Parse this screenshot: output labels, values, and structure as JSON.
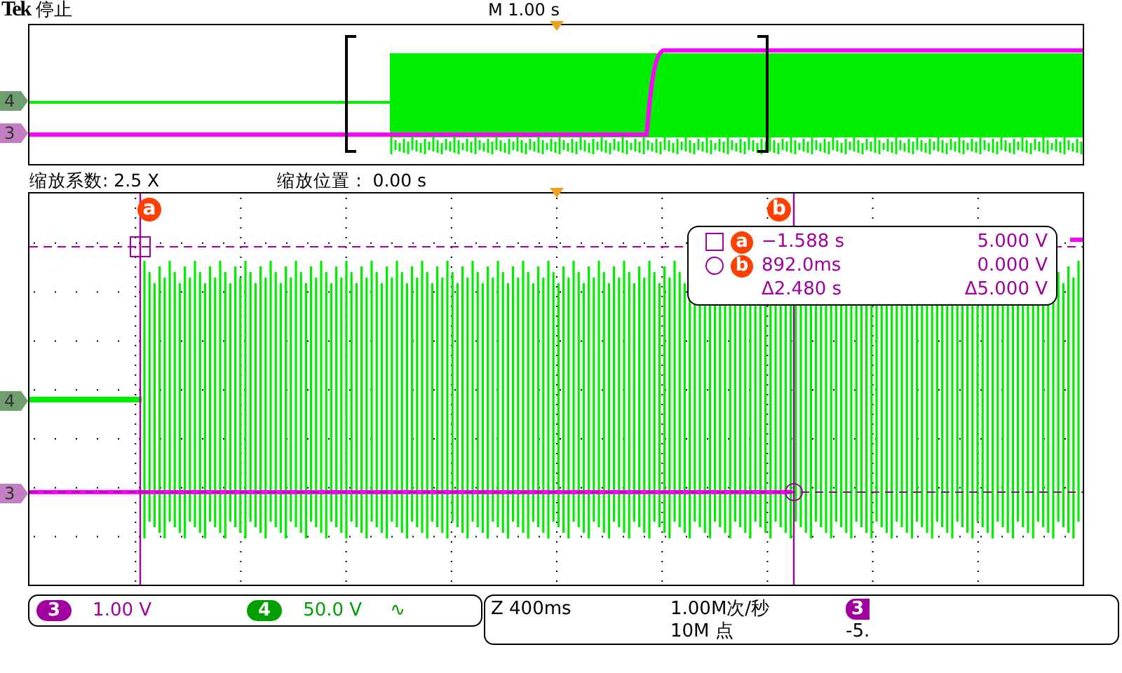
{
  "header": {
    "brand": "Tek",
    "status": "停止",
    "timebase": "M 1.00 s"
  },
  "overview": {
    "channel_markers": [
      {
        "label": "4",
        "color": "#6f9f6f"
      },
      {
        "label": "3",
        "color": "#c47fc4"
      }
    ]
  },
  "zoom_info": {
    "factor": "缩放系数: 2.5 X",
    "position": "缩放位置 :  0.00 s"
  },
  "main": {
    "channel_markers": [
      {
        "label": "4",
        "color": "#6f9f6f"
      },
      {
        "label": "3",
        "color": "#c47fc4"
      }
    ],
    "cursor_labels": [
      "a",
      "b"
    ],
    "readout": [
      {
        "kind": "square",
        "cursor": "a",
        "time": "−1.588 s",
        "value": "5.000 V"
      },
      {
        "kind": "circle",
        "cursor": "b",
        "time": "892.0ms",
        "value": "0.000 V"
      },
      {
        "kind": "delta",
        "time": "Δ2.480 s",
        "value": "Δ5.000 V"
      }
    ]
  },
  "status_bar": {
    "channels": [
      {
        "number": "3",
        "scale": "1.00 V",
        "color": "#a000a0"
      },
      {
        "number": "4",
        "scale": "50.0 V",
        "color": "#00a000",
        "coupling": "∿"
      }
    ],
    "horizontal": {
      "zoom": "Z 400ms",
      "sample_rate": "1.00M次/秒",
      "record_length": "10M 点"
    },
    "trigger": {
      "source": "3",
      "level": "-5."
    }
  }
}
